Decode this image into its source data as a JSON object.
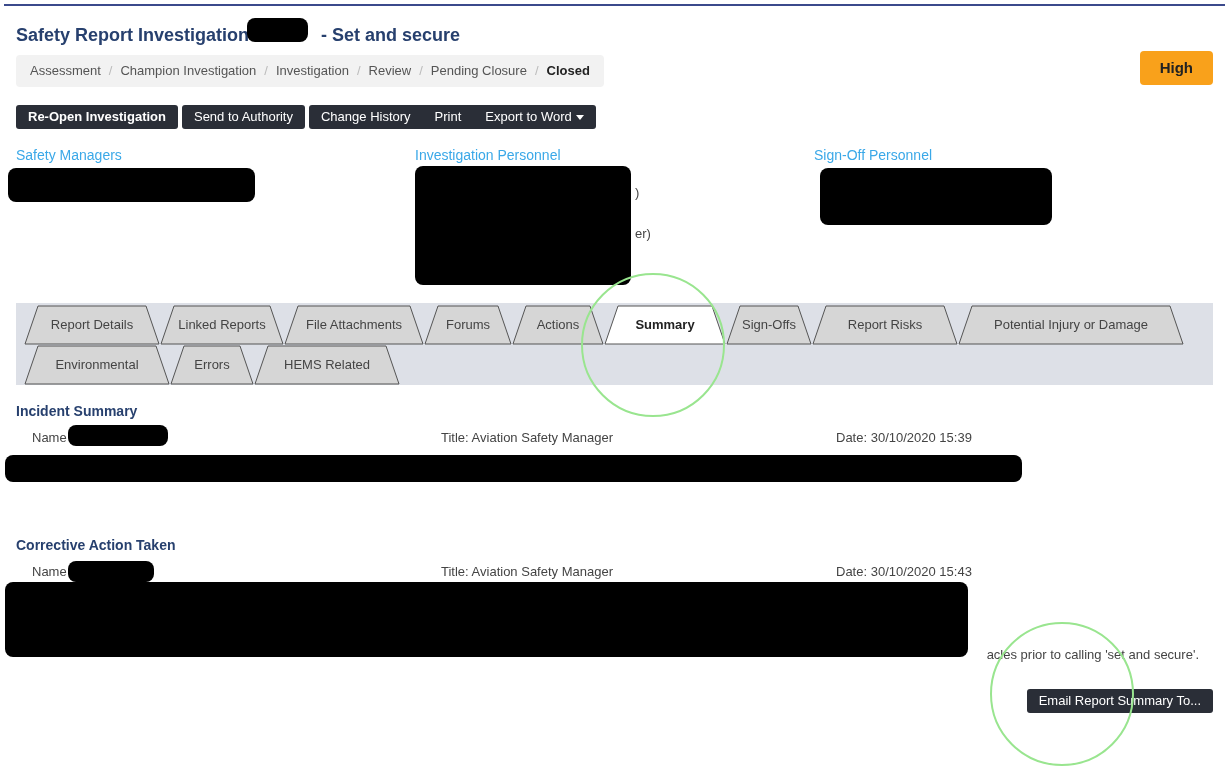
{
  "title": {
    "lead": "Safety Report Investigation",
    "tail": "- Set and secure"
  },
  "breadcrumb": [
    {
      "label": "Assessment",
      "selected": false
    },
    {
      "label": "Champion Investigation",
      "selected": false
    },
    {
      "label": "Investigation",
      "selected": false
    },
    {
      "label": "Review",
      "selected": false
    },
    {
      "label": "Pending Closure",
      "selected": false
    },
    {
      "label": "Closed",
      "selected": true
    }
  ],
  "separator": "/",
  "priority": {
    "label": "High"
  },
  "toolbar": [
    [
      {
        "label": "Re-Open Investigation",
        "kind": "primary"
      }
    ],
    [
      {
        "label": "Send to Authority",
        "kind": "plain"
      }
    ],
    [
      {
        "label": "Change History",
        "kind": "plain"
      },
      {
        "label": "Print",
        "kind": "plain"
      },
      {
        "label": "Export to Word",
        "kind": "dropdown"
      }
    ]
  ],
  "personnel": [
    {
      "heading": "Safety Managers"
    },
    {
      "heading": "Investigation Personnel",
      "fragments": [
        ")",
        "er)"
      ]
    },
    {
      "heading": "Sign-Off Personnel"
    }
  ],
  "tabs": [
    [
      {
        "label": "Report Details",
        "selected": false
      },
      {
        "label": "Linked Reports",
        "selected": false
      },
      {
        "label": "File Attachments",
        "selected": false
      },
      {
        "label": "Forums",
        "selected": false
      },
      {
        "label": "Actions",
        "selected": false
      },
      {
        "label": "Summary",
        "selected": true
      },
      {
        "label": "Sign-Offs",
        "selected": false
      },
      {
        "label": "Report Risks",
        "selected": false
      },
      {
        "label": "Potential Injury or Damage",
        "selected": false
      }
    ],
    [
      {
        "label": "Environmental",
        "selected": false
      },
      {
        "label": "Errors",
        "selected": false
      },
      {
        "label": "HEMS Related",
        "selected": false
      }
    ]
  ],
  "sections": [
    {
      "heading": "Incident Summary",
      "name": "Name",
      "title": "Title:  Aviation Safety Manager",
      "date": "Date:  30/10/2020 15:39"
    },
    {
      "heading": "Corrective Action Taken",
      "name": "Name",
      "title": "Title:  Aviation Safety Manager",
      "date": "Date:  30/10/2020 15:43",
      "fragment": "acles prior to calling 'set and secure'."
    }
  ],
  "email_button": {
    "label": "Email Report Summary To..."
  }
}
